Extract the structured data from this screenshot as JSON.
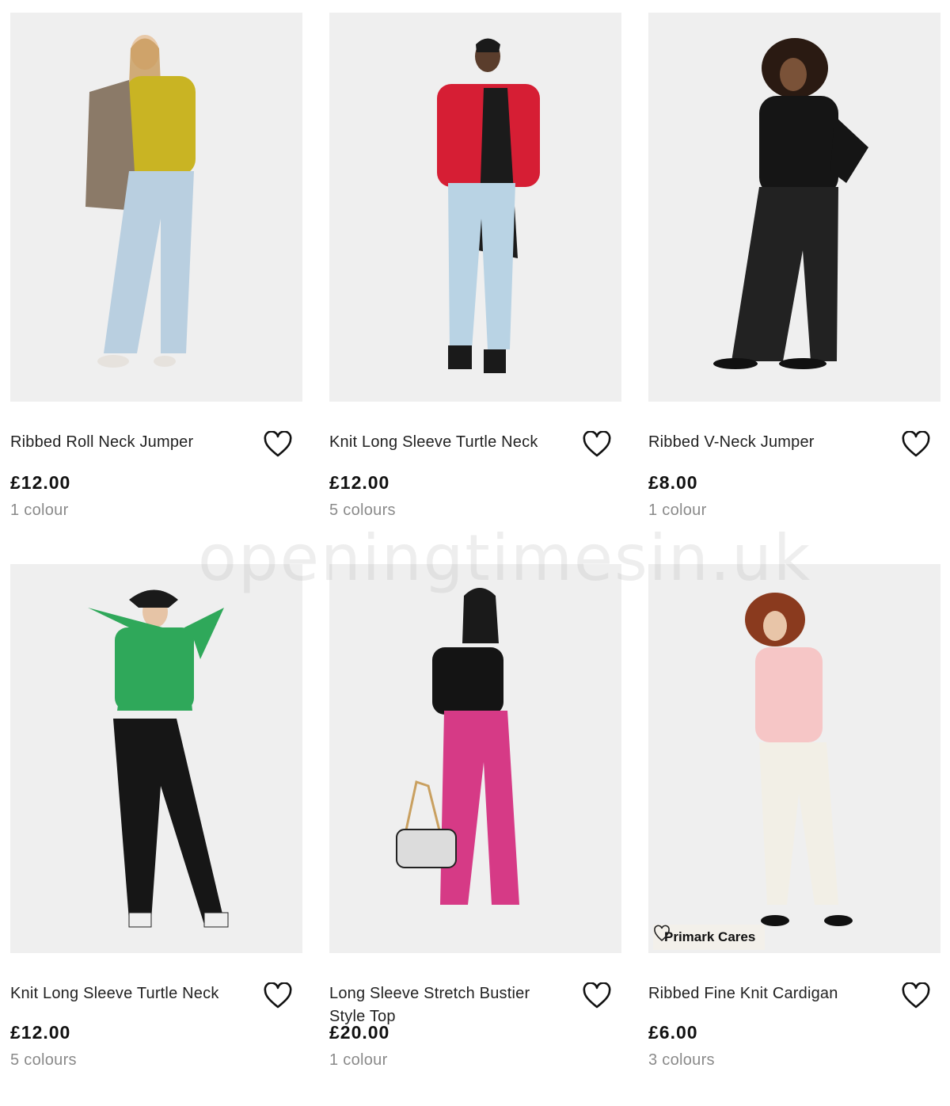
{
  "watermark": "openingtimesin.uk",
  "products": [
    {
      "title": "Ribbed Roll Neck Jumper",
      "price": "£12.00",
      "colours": "1 colour"
    },
    {
      "title": "Knit Long Sleeve Turtle Neck",
      "price": "£12.00",
      "colours": "5 colours"
    },
    {
      "title": "Ribbed V-Neck Jumper",
      "price": "£8.00",
      "colours": "1 colour"
    },
    {
      "title": "Knit Long Sleeve Turtle Neck",
      "price": "£12.00",
      "colours": "5 colours"
    },
    {
      "title": "Long Sleeve Stretch Bustier Style Top",
      "price": "£20.00",
      "colours": "1 colour"
    },
    {
      "title": "Ribbed Fine Knit Cardigan",
      "price": "£6.00",
      "colours": "3 colours",
      "badge": "Primark Cares"
    }
  ]
}
